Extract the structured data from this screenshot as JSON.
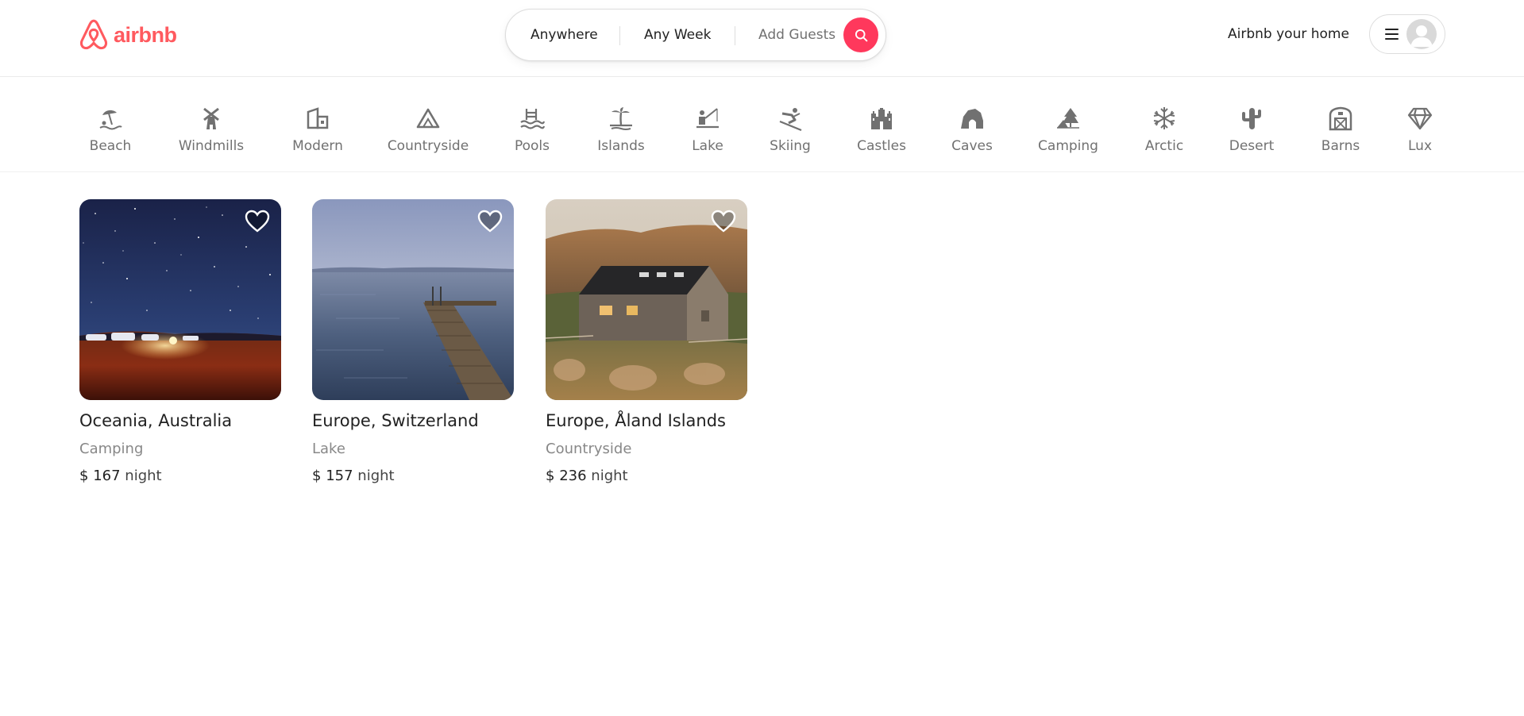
{
  "brand": {
    "name": "airbnb",
    "color": "#ff5a5f",
    "accent": "#ff385c"
  },
  "search": {
    "location": "Anywhere",
    "dates": "Any Week",
    "guests": "Add Guests",
    "icon": "search-icon"
  },
  "header": {
    "host_link": "Airbnb your home",
    "menu_icon": "hamburger-icon",
    "avatar_icon": "user-avatar-icon"
  },
  "categories": [
    {
      "label": "Beach",
      "icon": "beach-icon"
    },
    {
      "label": "Windmills",
      "icon": "windmill-icon"
    },
    {
      "label": "Modern",
      "icon": "modern-house-icon"
    },
    {
      "label": "Countryside",
      "icon": "mountain-icon"
    },
    {
      "label": "Pools",
      "icon": "pool-icon"
    },
    {
      "label": "Islands",
      "icon": "palm-tree-icon"
    },
    {
      "label": "Lake",
      "icon": "lake-icon"
    },
    {
      "label": "Skiing",
      "icon": "skier-icon"
    },
    {
      "label": "Castles",
      "icon": "castle-icon"
    },
    {
      "label": "Caves",
      "icon": "cave-icon"
    },
    {
      "label": "Camping",
      "icon": "camping-tent-icon"
    },
    {
      "label": "Arctic",
      "icon": "snowflake-icon"
    },
    {
      "label": "Desert",
      "icon": "cactus-icon"
    },
    {
      "label": "Barns",
      "icon": "barn-icon"
    },
    {
      "label": "Lux",
      "icon": "diamond-icon"
    }
  ],
  "listings": [
    {
      "location": "Oceania, Australia",
      "category": "Camping",
      "currency": "$",
      "price": "167",
      "unit": "night",
      "image": "night-sky-camping-photo"
    },
    {
      "location": "Europe, Switzerland",
      "category": "Lake",
      "currency": "$",
      "price": "157",
      "unit": "night",
      "image": "lake-pier-photo"
    },
    {
      "location": "Europe, Åland Islands",
      "category": "Countryside",
      "currency": "$",
      "price": "236",
      "unit": "night",
      "image": "countryside-cabin-photo"
    }
  ]
}
